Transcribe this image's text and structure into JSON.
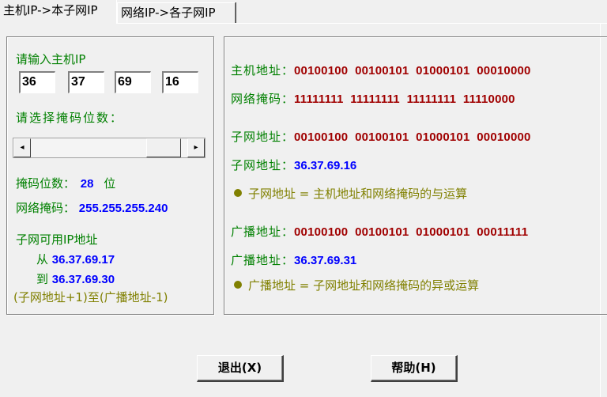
{
  "tabs": [
    {
      "label": "主机IP->本子网IP",
      "active": true
    },
    {
      "label": "网络IP->各子网IP",
      "active": false
    }
  ],
  "left": {
    "prompt_host_ip": "请输入主机IP",
    "ip_octets": [
      "36",
      "37",
      "69",
      "16"
    ],
    "prompt_mask_bits": "请选择掩码位数：",
    "mask_bits_label": "掩码位数：",
    "mask_bits_value": "28",
    "mask_bits_unit": "位",
    "netmask_label": "网络掩码：",
    "netmask_value": "255.255.255.240",
    "usable_title": "子网可用IP地址",
    "from_label": "从",
    "from_value": "36.37.69.17",
    "to_label": "到",
    "to_value": "36.37.69.30",
    "range_note": "(子网地址+1)至(广播地址-1)"
  },
  "scrollbar": {
    "left_arrow": "◂",
    "right_arrow": "▸",
    "min": 0,
    "max": 32,
    "value": 28
  },
  "right": {
    "host_addr_label": "主机地址：",
    "host_addr_bin": "00100100  00100101  01000101  00010000",
    "netmask_label": "网络掩码：",
    "netmask_bin": "11111111  11111111  11111111  11110000",
    "subnet_label": "子网地址：",
    "subnet_bin": "00100100  00100101  01000101  00010000",
    "subnet_label2": "子网地址：",
    "subnet_dec": "36.37.69.16",
    "subnet_note": "子网地址 = 主机地址和网络掩码的与运算",
    "broadcast_label": "广播地址：",
    "broadcast_bin": "00100100  00100101  01000101  00011111",
    "broadcast_label2": "广播地址：",
    "broadcast_dec": "36.37.69.31",
    "broadcast_note": "广播地址 = 子网地址和网络掩码的异或运算"
  },
  "buttons": {
    "exit": "退出(X)",
    "help": "帮助(H)"
  }
}
